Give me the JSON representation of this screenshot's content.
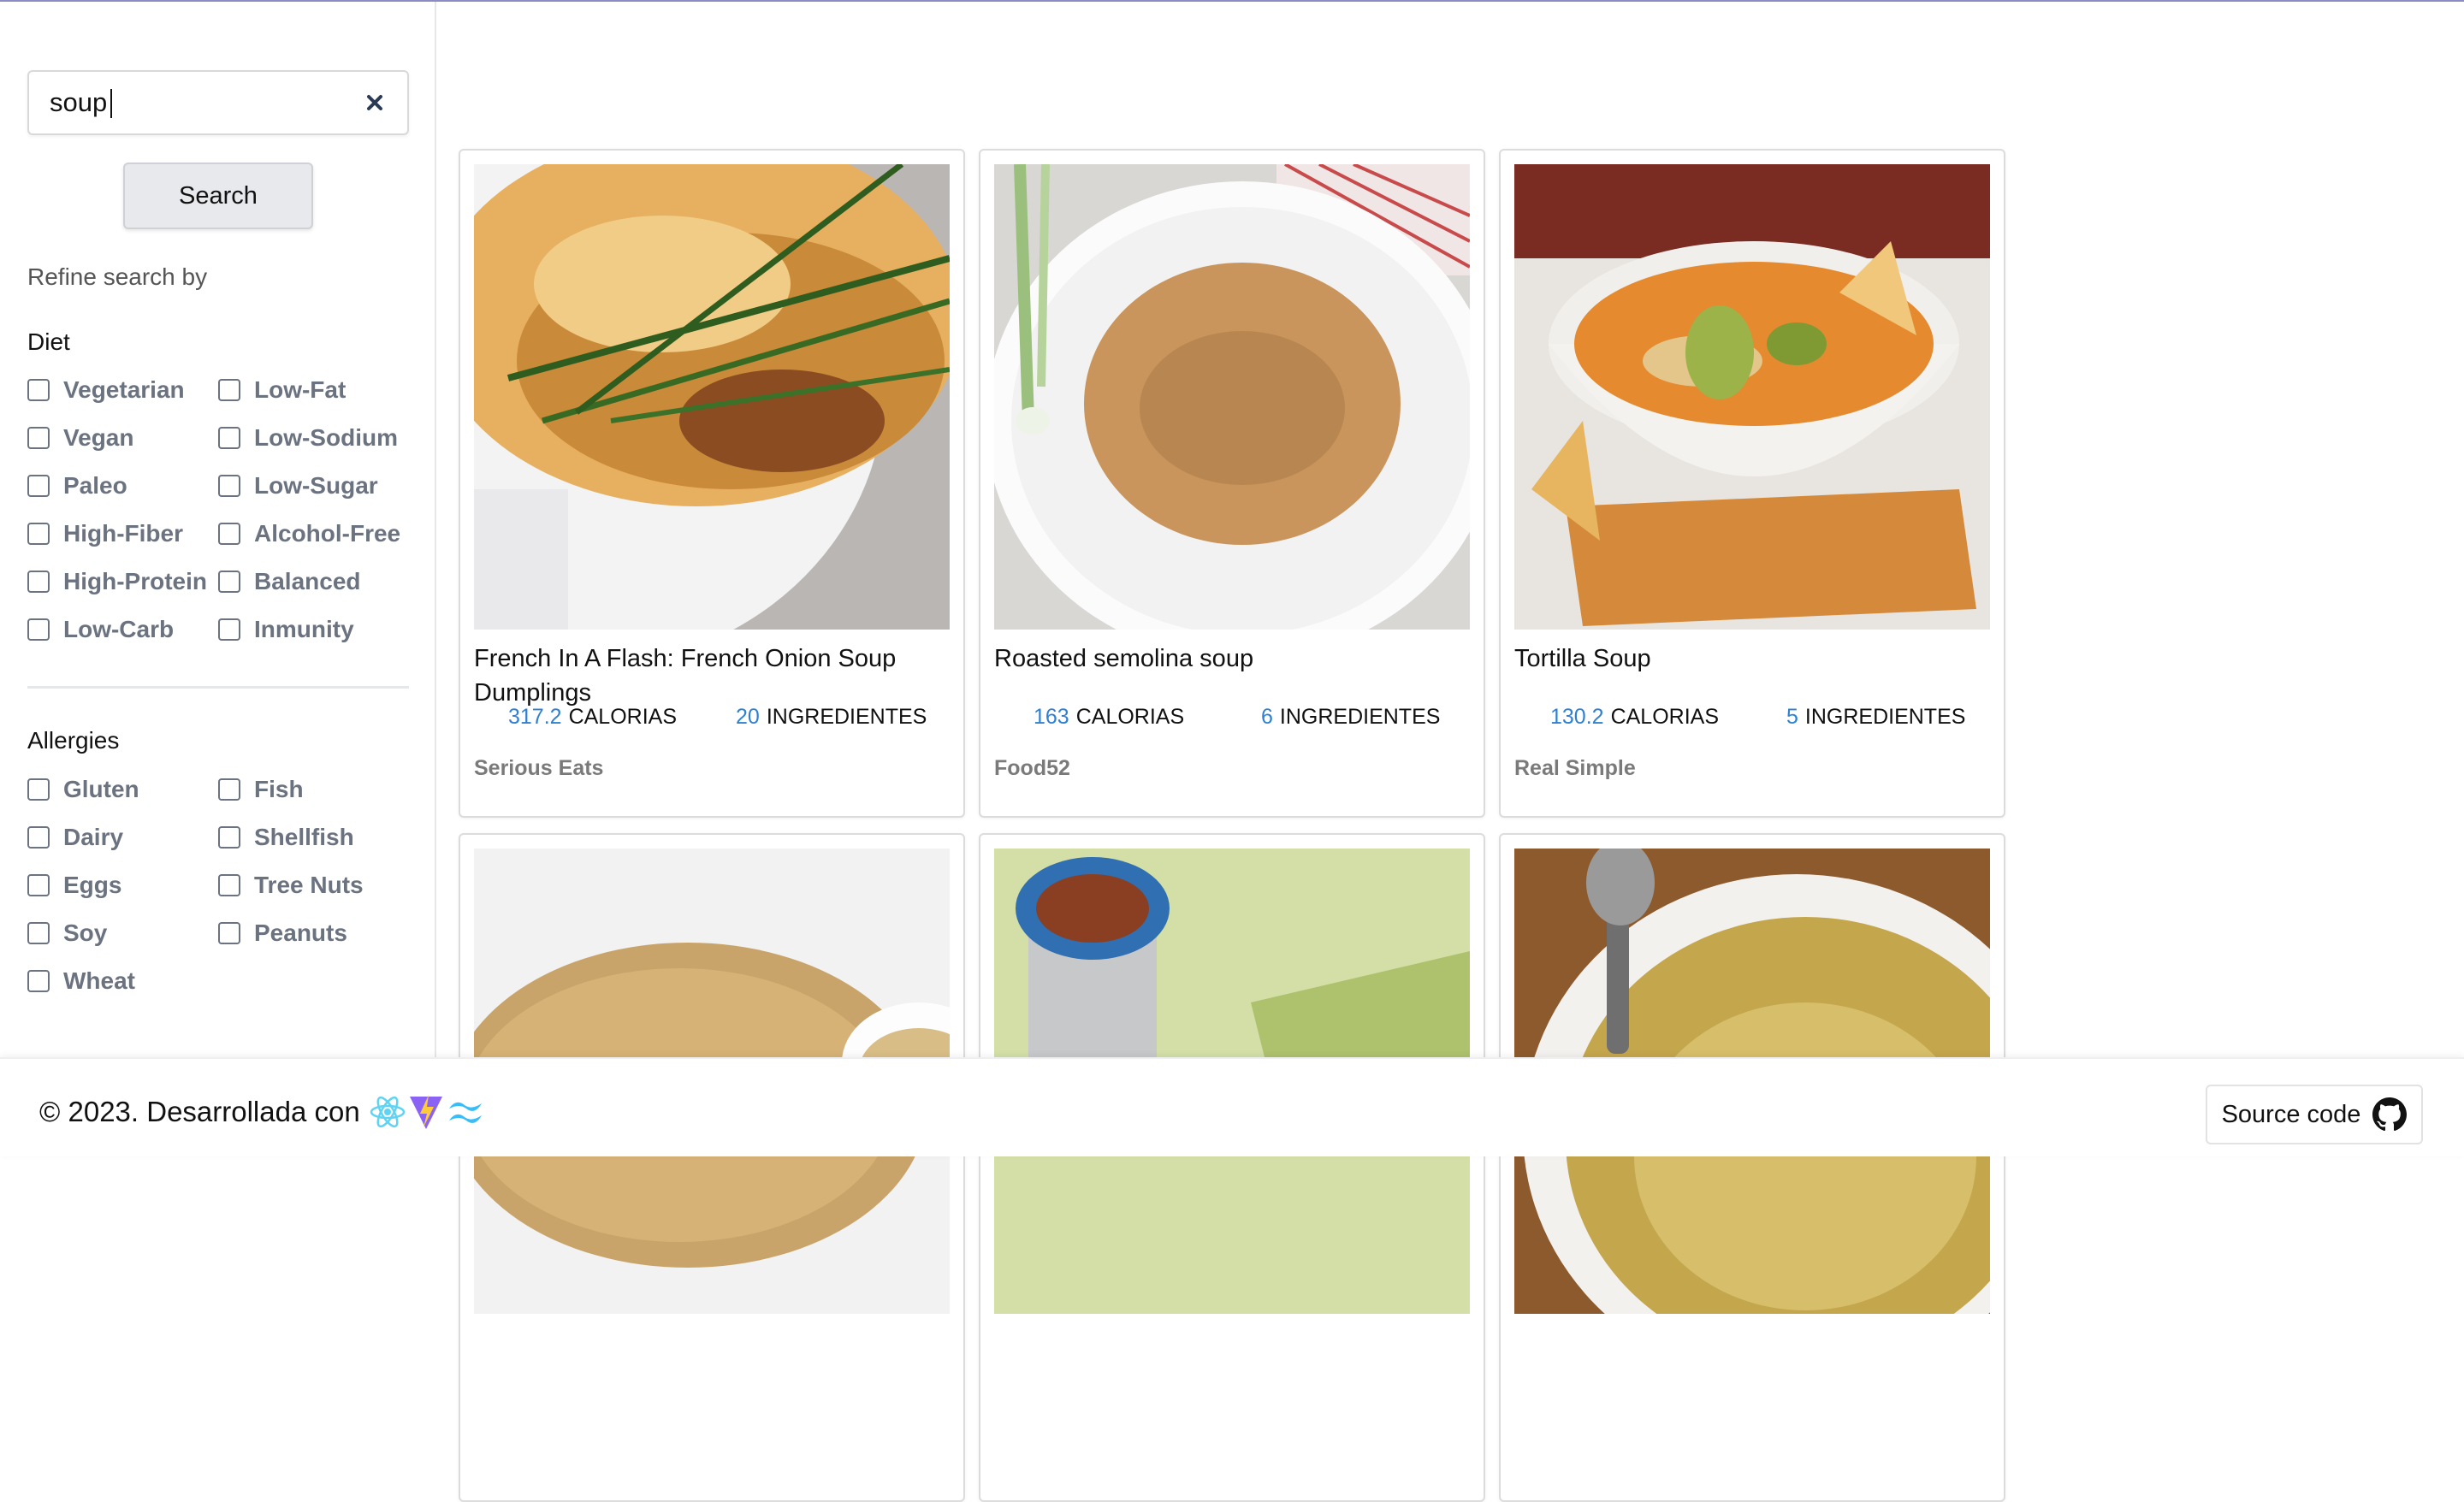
{
  "search": {
    "value": "soup",
    "button_label": "Search"
  },
  "sidebar": {
    "refine_label": "Refine search by",
    "diet": {
      "title": "Diet",
      "options_left": [
        "Vegetarian",
        "Vegan",
        "Paleo",
        "High-Fiber",
        "High-Protein",
        "Low-Carb"
      ],
      "options_right": [
        "Low-Fat",
        "Low-Sodium",
        "Low-Sugar",
        "Alcohol-Free",
        "Balanced",
        "Inmunity"
      ]
    },
    "allergies": {
      "title": "Allergies",
      "options_left": [
        "Gluten",
        "Dairy",
        "Eggs",
        "Soy",
        "Wheat"
      ],
      "options_right": [
        "Fish",
        "Shellfish",
        "Tree Nuts",
        "Peanuts"
      ]
    }
  },
  "recipes": [
    {
      "title": "French In A Flash: French Onion Soup Dumplings",
      "calories": "317.2",
      "calories_label": "CALORIAS",
      "ingredients": "20",
      "ingredients_label": "INGREDIENTES",
      "source": "Serious Eats"
    },
    {
      "title": "Roasted semolina soup",
      "calories": "163",
      "calories_label": "CALORIAS",
      "ingredients": "6",
      "ingredients_label": "INGREDIENTES",
      "source": "Food52"
    },
    {
      "title": "Tortilla Soup",
      "calories": "130.2",
      "calories_label": "CALORIAS",
      "ingredients": "5",
      "ingredients_label": "INGREDIENTES",
      "source": "Real Simple"
    }
  ],
  "footer": {
    "copyright": "© 2023. Desarrollada con",
    "source_code_label": "Source code"
  },
  "colors": {
    "accent_number": "#2f80d1",
    "option_text": "#6b7280"
  },
  "icons": [
    "clear-icon",
    "react-icon",
    "vite-icon",
    "tailwind-icon",
    "github-icon"
  ]
}
